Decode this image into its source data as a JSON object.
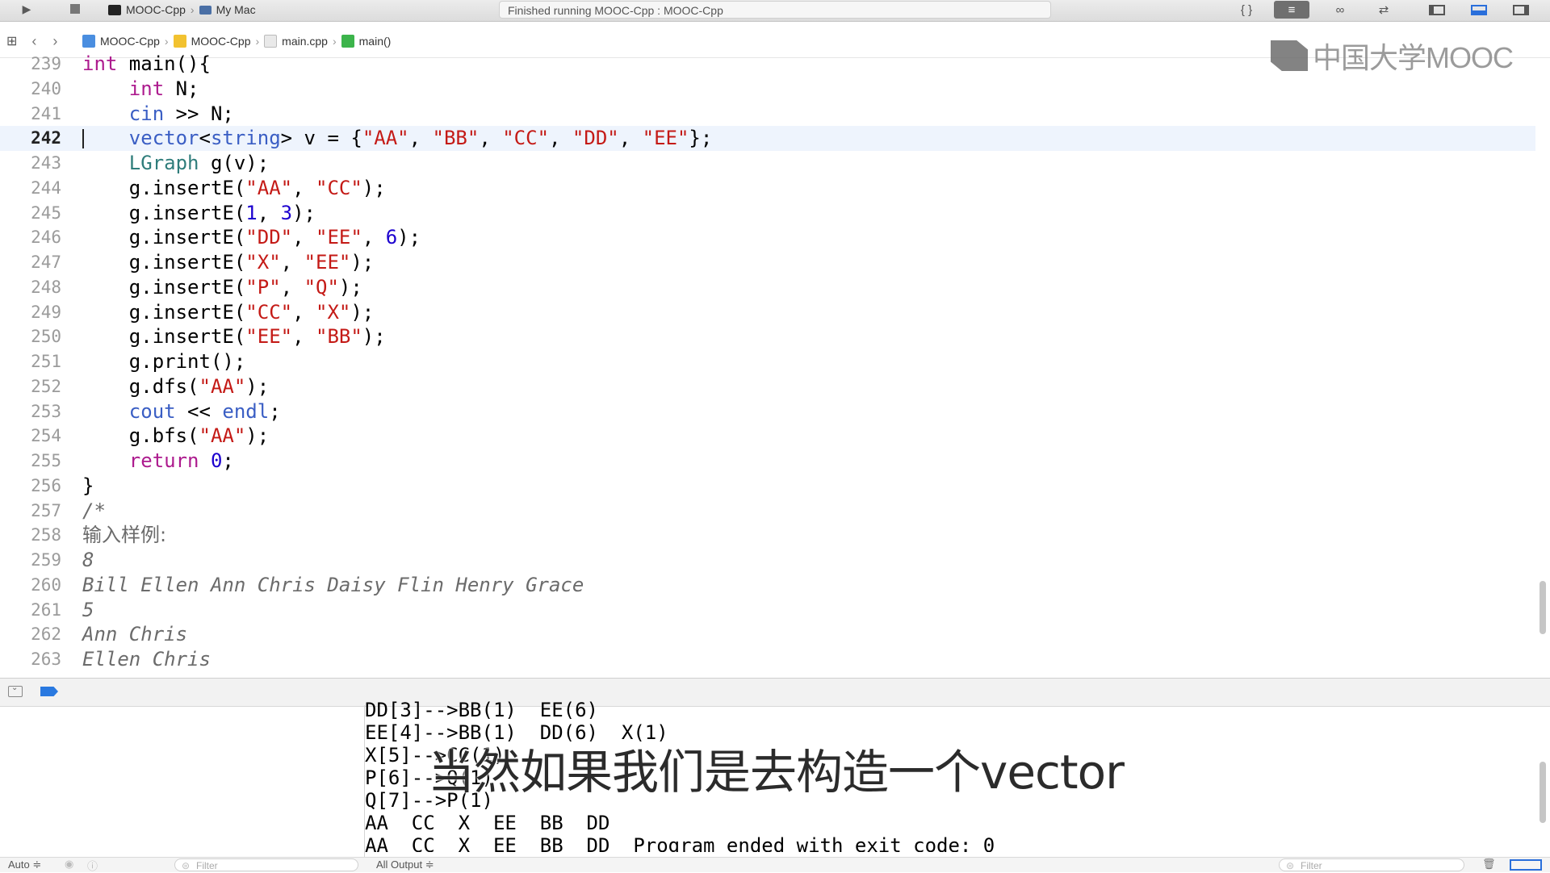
{
  "toolbar": {
    "scheme": "MOOC-Cpp",
    "destination": "My Mac",
    "status": "Finished running MOOC-Cpp : MOOC-Cpp"
  },
  "breadcrumbs": [
    "MOOC-Cpp",
    "MOOC-Cpp",
    "main.cpp",
    "main()"
  ],
  "watermark": "中国大学MOOC",
  "editor": {
    "current_line": 242,
    "lines": [
      {
        "n": "239",
        "html": "<span class=\"kw\">int</span> main(){"
      },
      {
        "n": "240",
        "html": "    <span class=\"kw\">int</span> N;"
      },
      {
        "n": "241",
        "html": "    <span class=\"fn\">cin</span> &gt;&gt; N;"
      },
      {
        "n": "242",
        "html": "    <span class=\"fn\">vector</span>&lt;<span class=\"fn\">string</span>&gt; v = {<span class=\"str\">\"AA\"</span>, <span class=\"str\">\"BB\"</span>, <span class=\"str\">\"CC\"</span>, <span class=\"str\">\"DD\"</span>, <span class=\"str\">\"EE\"</span>};"
      },
      {
        "n": "243",
        "html": "    <span class=\"ty\">LGraph</span> g(v);"
      },
      {
        "n": "244",
        "html": "    g.insertE(<span class=\"str\">\"AA\"</span>, <span class=\"str\">\"CC\"</span>);"
      },
      {
        "n": "245",
        "html": "    g.insertE(<span class=\"num\">1</span>, <span class=\"num\">3</span>);"
      },
      {
        "n": "246",
        "html": "    g.insertE(<span class=\"str\">\"DD\"</span>, <span class=\"str\">\"EE\"</span>, <span class=\"num\">6</span>);"
      },
      {
        "n": "247",
        "html": "    g.insertE(<span class=\"str\">\"X\"</span>, <span class=\"str\">\"EE\"</span>);"
      },
      {
        "n": "248",
        "html": "    g.insertE(<span class=\"str\">\"P\"</span>, <span class=\"str\">\"Q\"</span>);"
      },
      {
        "n": "249",
        "html": "    g.insertE(<span class=\"str\">\"CC\"</span>, <span class=\"str\">\"X\"</span>);"
      },
      {
        "n": "250",
        "html": "    g.insertE(<span class=\"str\">\"EE\"</span>, <span class=\"str\">\"BB\"</span>);"
      },
      {
        "n": "251",
        "html": "    g.print();"
      },
      {
        "n": "252",
        "html": "    g.dfs(<span class=\"str\">\"AA\"</span>);"
      },
      {
        "n": "253",
        "html": "    <span class=\"fn\">cout</span> &lt;&lt; <span class=\"fn\">endl</span>;"
      },
      {
        "n": "254",
        "html": "    g.bfs(<span class=\"str\">\"AA\"</span>);"
      },
      {
        "n": "255",
        "html": "    <span class=\"kw\">return</span> <span class=\"num\">0</span>;"
      },
      {
        "n": "256",
        "html": "}"
      },
      {
        "n": "257",
        "html": "<span class=\"cm\">/*</span>"
      },
      {
        "n": "258",
        "html": "<span class=\"cm\" style=\"font-family:'DejaVu Sans',sans-serif;font-style:normal;\">输入样例:</span>"
      },
      {
        "n": "259",
        "html": "<span class=\"cm\">8</span>"
      },
      {
        "n": "260",
        "html": "<span class=\"cm\">Bill Ellen Ann Chris Daisy Flin Henry Grace</span>"
      },
      {
        "n": "261",
        "html": "<span class=\"cm\">5</span>"
      },
      {
        "n": "262",
        "html": "<span class=\"cm\">Ann Chris</span>"
      },
      {
        "n": "263",
        "html": "<span class=\"cm\">Ellen Chris</span>"
      }
    ]
  },
  "console": {
    "lines": [
      "DD[3]-->BB(1)  EE(6)",
      "EE[4]-->BB(1)  DD(6)  X(1)",
      "X[5]-->CC(1)",
      "P[6]-->Q(1)",
      "Q[7]-->P(1)",
      "AA  CC  X  EE  BB  DD",
      "AA  CC  X  EE  BB  DD  Program ended with exit code: 0"
    ],
    "subtitle": "当然如果我们是去构造一个vector"
  },
  "bottom": {
    "auto_label": "Auto ≑",
    "filter_placeholder": "Filter",
    "output_label": "All Output ≑"
  }
}
